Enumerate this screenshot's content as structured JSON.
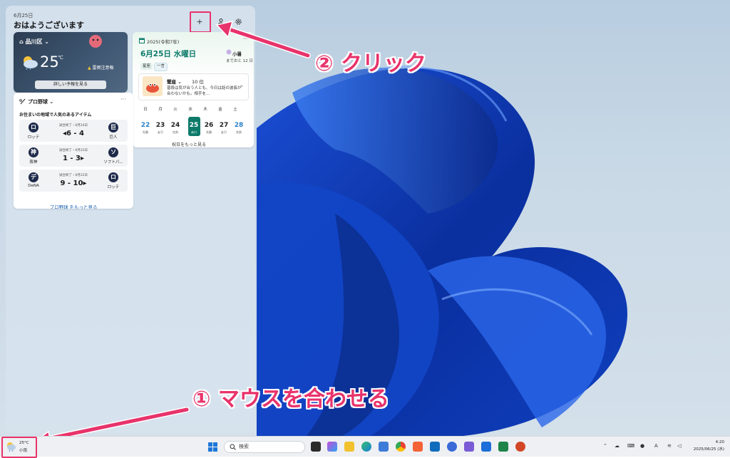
{
  "panel": {
    "date": "6月25日",
    "greeting": "おはようございます",
    "add_label": "+"
  },
  "weather": {
    "location": "品川区",
    "temperature": "25",
    "unit": "℃",
    "alert": "雷雨注意報",
    "forecast_button": "詳しい予報を見る"
  },
  "calendar": {
    "year_label": "2025(令和7年)",
    "date_label": "6月25日 水曜日",
    "user_label": "小暑",
    "remaining": "までおと 12 日",
    "chips": [
      "星座",
      "一言"
    ],
    "horoscope": {
      "sign": "蟹座",
      "rank": "10 位",
      "text": "普段は気が合う人とも、今日は話の波長が合わないかも。相手を..."
    },
    "weekdays": [
      "日",
      "月",
      "火",
      "水",
      "木",
      "金",
      "土"
    ],
    "days": [
      {
        "num": "22",
        "label": "先勝",
        "color": "#2a7fc9"
      },
      {
        "num": "23",
        "label": "友引",
        "color": "#222222"
      },
      {
        "num": "24",
        "label": "先負",
        "color": "#222222"
      },
      {
        "num": "25",
        "label": "赤口",
        "color": "#ffffff"
      },
      {
        "num": "26",
        "label": "先勝",
        "color": "#222222"
      },
      {
        "num": "27",
        "label": "友引",
        "color": "#222222"
      },
      {
        "num": "28",
        "label": "先負",
        "color": "#2a7fc9"
      }
    ],
    "more_link": "祝日をもっと見る"
  },
  "baseball": {
    "title": "プロ野球",
    "subtitle": "お住まいの地域で人気のあるアイテム",
    "matches": [
      {
        "home_logo": "ロ",
        "home": "ロッテ",
        "status": "試合終了・6月24日",
        "score": "◂6 - 4",
        "away_logo": "巨",
        "away": "巨人"
      },
      {
        "home_logo": "神",
        "home": "阪神",
        "status": "試合終了・6月22日",
        "score": "1 - 3▸",
        "away_logo": "ソ",
        "away": "ソフトバ..."
      },
      {
        "home_logo": "デ",
        "home": "DeNA",
        "status": "試合終了・6月22日",
        "score": "9 - 10▸",
        "away_logo": "ロ",
        "away": "ロッテ"
      }
    ],
    "more_link": "プロ野球 をもっと見る"
  },
  "annotations": {
    "step2": "② クリック",
    "step1": "① マウスを合わせる"
  },
  "taskbar": {
    "weather_temp": "25°C",
    "weather_cond": "小雨",
    "search_placeholder": "検索",
    "time": "4:20",
    "date": "2025/06/25 (水)"
  },
  "colors": {
    "accent": "#0d7a6a",
    "annotation": "#e8336b",
    "link": "#1a5fb4"
  }
}
